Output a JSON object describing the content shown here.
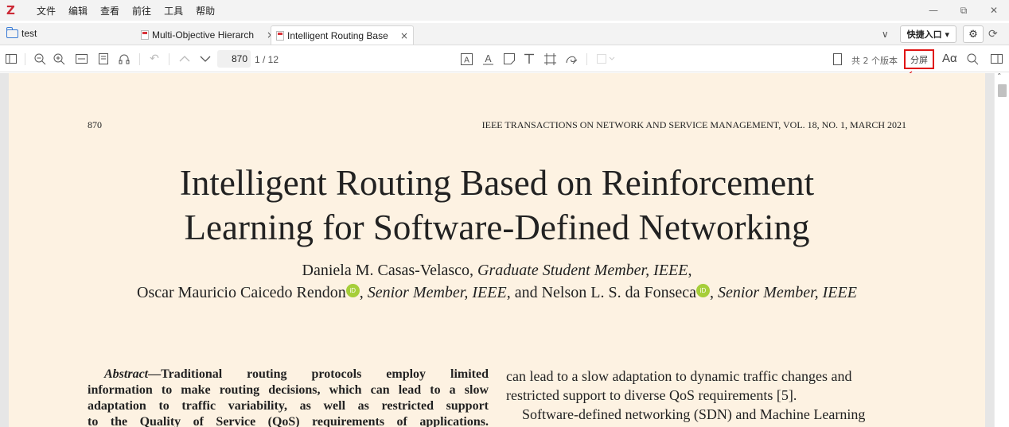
{
  "app": {
    "logo": "Z"
  },
  "menu": [
    "文件",
    "编辑",
    "查看",
    "前往",
    "工具",
    "帮助"
  ],
  "window_controls": {
    "minimize": "—",
    "restore": "⧉",
    "close": "✕"
  },
  "tabs": {
    "library": "test",
    "documents": [
      {
        "title": "Multi-Objective Hierarch",
        "active": false
      },
      {
        "title": "Intelligent Routing Base",
        "active": true
      }
    ],
    "close_glyph": "×",
    "list_chevron": "∨",
    "quick_access": "快捷入口 ▾",
    "settings_glyph": "⚙",
    "sync_glyph": "⟳"
  },
  "toolbar": {
    "page_input": "870",
    "page_total": "1 / 12",
    "versions_label": "共 2 个版本",
    "split_label": "分屏",
    "font_label": "Aα",
    "icons": [
      "sidebar-toggle-icon",
      "zoom-out-icon",
      "zoom-in-icon",
      "fit-width-icon",
      "page-view-icon",
      "read-aloud-icon",
      "undo-icon",
      "prev-page-icon",
      "next-page-icon",
      "highlight-icon",
      "underline-icon",
      "note-icon",
      "text-icon",
      "area-select-icon",
      "draw-icon",
      "color-picker-icon",
      "page-icon",
      "search-icon",
      "context-pane-icon"
    ]
  },
  "document": {
    "page_number": "870",
    "journal_line": "IEEE TRANSACTIONS ON NETWORK AND SERVICE MANAGEMENT, VOL. 18, NO. 1, MARCH 2021",
    "title_line1": "Intelligent Routing Based on Reinforcement",
    "title_line2": "Learning for Software-Defined Networking",
    "author1": "Daniela M. Casas-Velasco, ",
    "author1_role": "Graduate Student Member, IEEE",
    "author2": "Oscar Mauricio Caicedo Rendon",
    "author2_role": "Senior Member, IEEE",
    "author3": "Nelson L. S. da Fonseca",
    "author3_role": "Senior Member, IEEE",
    "and_text": "and",
    "orcid_label": "iD",
    "abstract_label": "Abstract",
    "abstract_lines": [
      "—Traditional routing protocols employ limited",
      "information to make routing decisions, which can lead to a slow",
      "adaptation to traffic variability, as well as restricted support",
      "to the Quality of Service (QoS) requirements of applications."
    ],
    "body_lines": [
      "can lead to a slow adaptation to dynamic traffic changes and",
      "restricted support to diverse QoS requirements [5].",
      "Software-defined networking (SDN) and Machine Learning"
    ]
  },
  "colors": {
    "page_bg": "#fdf2e2",
    "highlight_box": "#e01414",
    "logo": "#cc2936",
    "orcid": "#a6ce39"
  }
}
